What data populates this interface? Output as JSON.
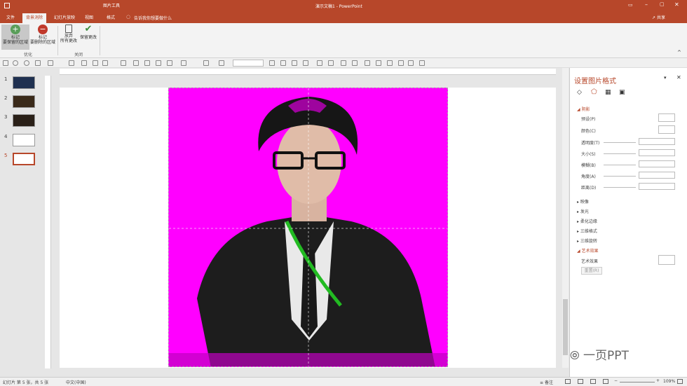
{
  "titlebar": {
    "context_tool": "图片工具",
    "doc_title": "演示文稿1 - PowerPoint"
  },
  "tabs": [
    {
      "label": "文件"
    },
    {
      "label": "背景消除",
      "active": true
    },
    {
      "label": "幻灯片放映"
    },
    {
      "label": "视图"
    },
    {
      "label": "格式"
    }
  ],
  "tell_me": "告诉我你想要做什么",
  "share": "共享",
  "ribbon": {
    "mark_keep": "标记\n要保留的区域",
    "mark_remove": "标记\n要删除的区域",
    "discard": "放弃\n所有更改",
    "keep": "保留更改",
    "group_refine": "优化",
    "group_close": "关闭"
  },
  "thumbs": [
    "1",
    "2",
    "3",
    "4",
    "5"
  ],
  "pane": {
    "title": "设置图片格式",
    "shadow": "阴影",
    "preset": "预设(P)",
    "color": "颜色(C)",
    "transparency": "透明度(T)",
    "size": "大小(S)",
    "blur": "模糊(B)",
    "angle": "角度(A)",
    "distance": "距离(D)",
    "reflection": "映像",
    "glow": "发光",
    "soft_edges": "柔化边缘",
    "three_d_format": "三维格式",
    "three_d_rotation": "三维旋转",
    "artistic": "艺术效果",
    "artistic_effect": "艺术效果",
    "reset": "重置(R)"
  },
  "status": {
    "slide": "幻灯片 第 5 张，共 5 张",
    "lang": "中文(中国)",
    "notes": "备注",
    "zoom": "109%"
  },
  "watermark": "一页PPT",
  "colors": {
    "accent": "#b7472a",
    "magenta": "#ff00ff"
  }
}
